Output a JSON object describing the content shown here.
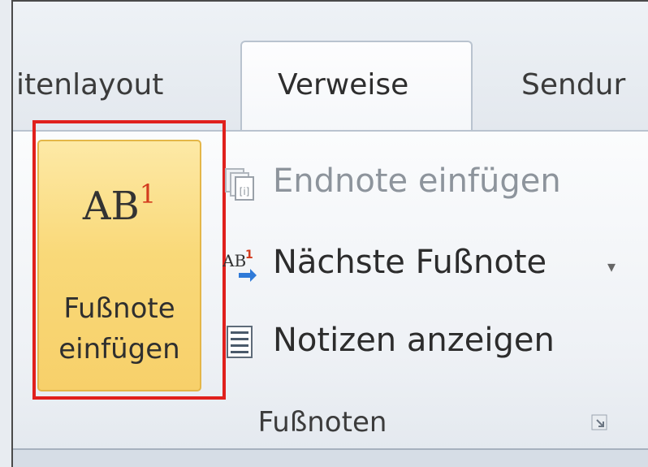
{
  "tabs": {
    "left_partial": "itenlayout",
    "active": "Verweise",
    "right_partial": "Sendur"
  },
  "group": {
    "insert_footnote": {
      "icon_text": "AB",
      "icon_sup": "1",
      "label_line1": "Fußnote",
      "label_line2": "einfügen"
    },
    "endnote": "Endnote einfügen",
    "next_footnote": "Nächste Fußnote",
    "show_notes": "Notizen anzeigen",
    "label": "Fußnoten"
  },
  "colors": {
    "highlight": "#f9d979",
    "selection_border": "#e0201c"
  }
}
